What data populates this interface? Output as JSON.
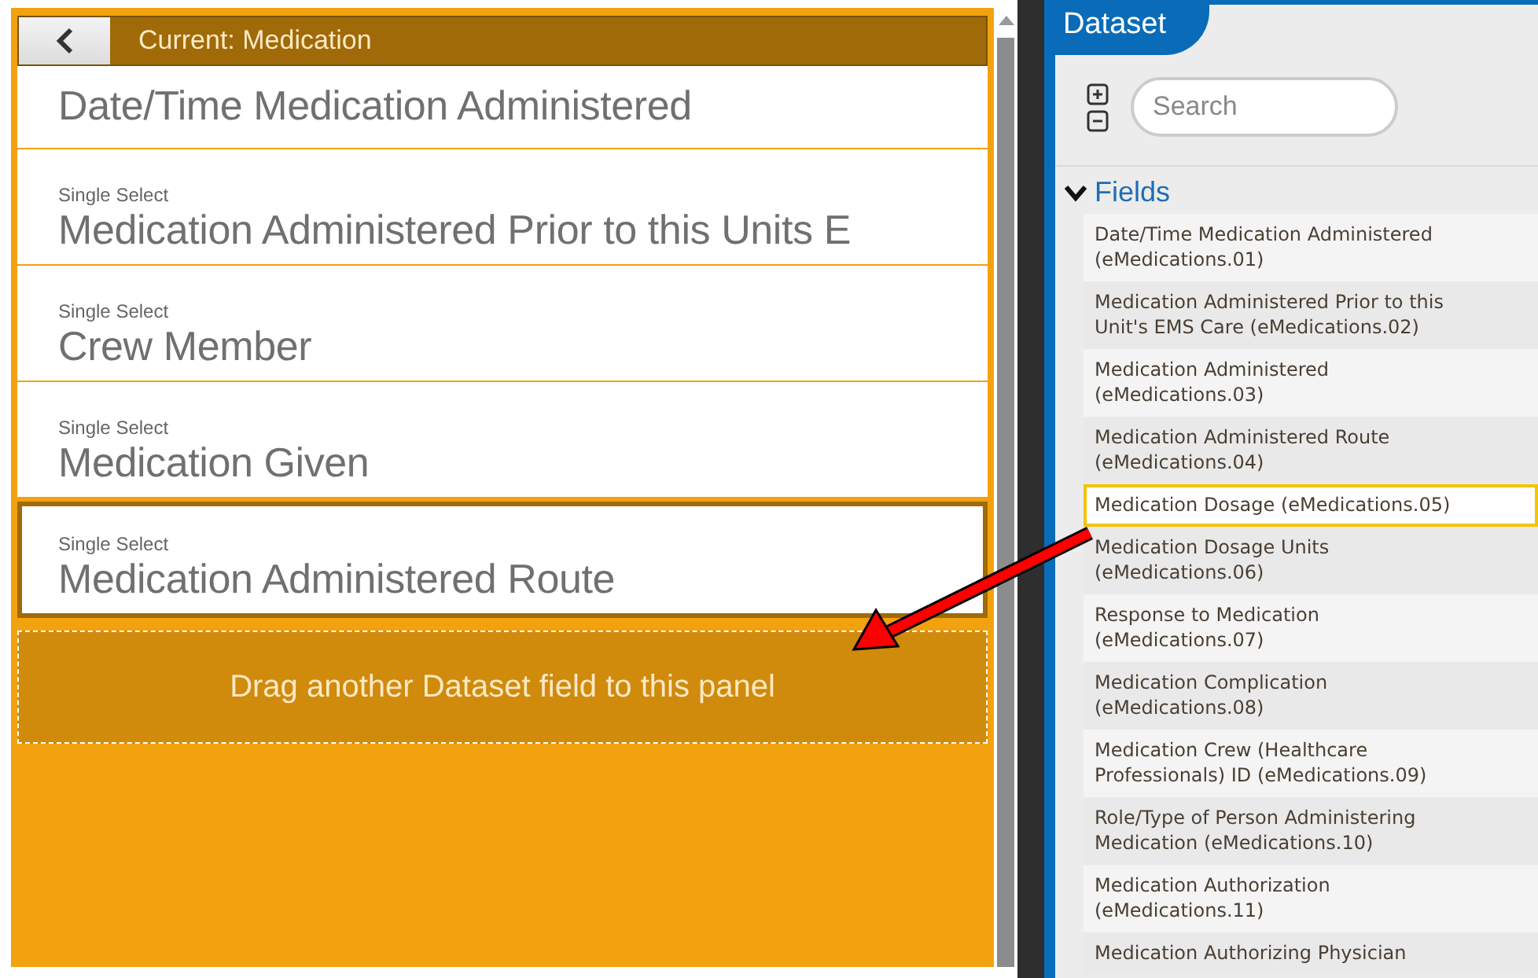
{
  "panel": {
    "title": "Current: Medication",
    "cards": [
      {
        "title": "Date/Time Medication Administered",
        "selected": false
      },
      {
        "label": "Single Select",
        "title": "Medication Administered Prior to this Units E",
        "selected": false
      },
      {
        "label": "Single Select",
        "title": "Crew Member",
        "selected": false
      },
      {
        "label": "Single Select",
        "title": "Medication Given",
        "selected": false
      },
      {
        "label": "Single Select",
        "title": "Medication Administered Route",
        "selected": true
      }
    ],
    "drop_zone": "Drag another Dataset field to this panel"
  },
  "dataset": {
    "title": "Dataset",
    "search": {
      "placeholder": "Search"
    },
    "group": {
      "label": "Fields",
      "expanded": true,
      "items": [
        {
          "label": "Date/Time Medication Administered (eMedications.01)",
          "selected": false
        },
        {
          "label": "Medication Administered Prior to this Unit's EMS Care (eMedications.02)",
          "selected": false
        },
        {
          "label": "Medication Administered (eMedications.03)",
          "selected": false
        },
        {
          "label": "Medication Administered Route (eMedications.04)",
          "selected": false
        },
        {
          "label": "Medication Dosage (eMedications.05)",
          "selected": true
        },
        {
          "label": "Medication Dosage Units (eMedications.06)",
          "selected": false
        },
        {
          "label": "Response to Medication (eMedications.07)",
          "selected": false
        },
        {
          "label": "Medication Complication (eMedications.08)",
          "selected": false
        },
        {
          "label": "Medication Crew (Healthcare Professionals) ID (eMedications.09)",
          "selected": false
        },
        {
          "label": "Role/Type of Person Administering Medication (eMedications.10)",
          "selected": false
        },
        {
          "label": "Medication Authorization (eMedications.11)",
          "selected": false
        },
        {
          "label": "Medication Authorizing Physician",
          "selected": false
        }
      ]
    }
  }
}
